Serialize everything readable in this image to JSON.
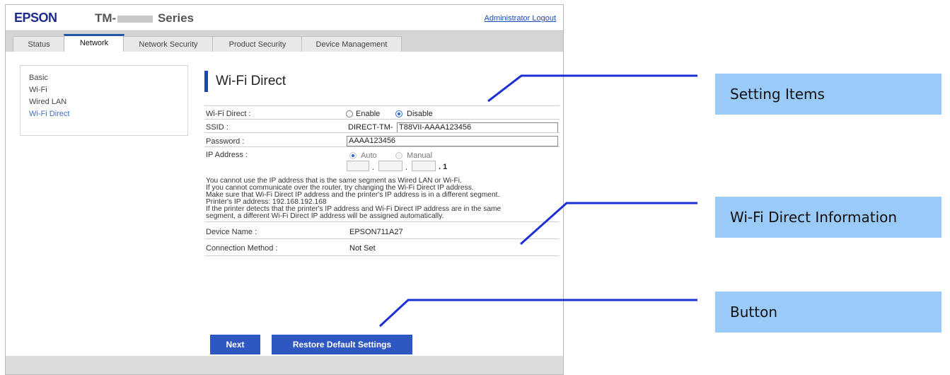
{
  "header": {
    "logo": "EPSON",
    "model_prefix": "TM-",
    "model_suffix": "Series",
    "logout": "Administrator Logout"
  },
  "tabs": [
    {
      "label": "Status"
    },
    {
      "label": "Network"
    },
    {
      "label": "Network Security"
    },
    {
      "label": "Product Security"
    },
    {
      "label": "Device Management"
    }
  ],
  "sidebar": {
    "items": [
      {
        "label": "Basic"
      },
      {
        "label": "Wi-Fi"
      },
      {
        "label": "Wired LAN"
      },
      {
        "label": "Wi-Fi Direct"
      }
    ]
  },
  "page": {
    "title": "Wi-Fi Direct",
    "wifi_direct": {
      "label": "Wi-Fi Direct :",
      "enable": "Enable",
      "disable": "Disable",
      "selected": "Disable"
    },
    "ssid": {
      "label": "SSID :",
      "prefix": "DIRECT-TM-",
      "value": "T88VII-AAAA123456"
    },
    "password": {
      "label": "Password :",
      "value": "AAAA123456"
    },
    "ip_address": {
      "label": "IP Address :",
      "auto": "Auto",
      "manual": "Manual",
      "last_octet": ". 1",
      "dot": "."
    },
    "notes": [
      "You cannot use the IP address that is the same segment as Wired LAN or Wi-Fi.",
      "If you cannot communicate over the router, try changing the Wi-Fi Direct IP address.",
      "Make sure that Wi-Fi Direct IP address and the printer's IP address is in a different segment.",
      "Printer's IP address: 192.168.192.168",
      "If the printer detects that the printer's IP address and Wi-Fi Direct IP address are in the same",
      "segment, a different Wi-Fi Direct IP address will be assigned automatically."
    ],
    "device_name": {
      "label": "Device Name :",
      "value": "EPSON711A27"
    },
    "connection_method": {
      "label": "Connection Method :",
      "value": "Not Set"
    },
    "buttons": {
      "next": "Next",
      "restore": "Restore Default Settings"
    }
  },
  "callouts": {
    "setting_items": "Setting Items",
    "wifi_direct_info": "Wi-Fi Direct Information",
    "button": "Button"
  },
  "colors": {
    "accent": "#2f57c2",
    "callout_bg": "#99caf8",
    "leader_line": "#1b2fd6"
  }
}
